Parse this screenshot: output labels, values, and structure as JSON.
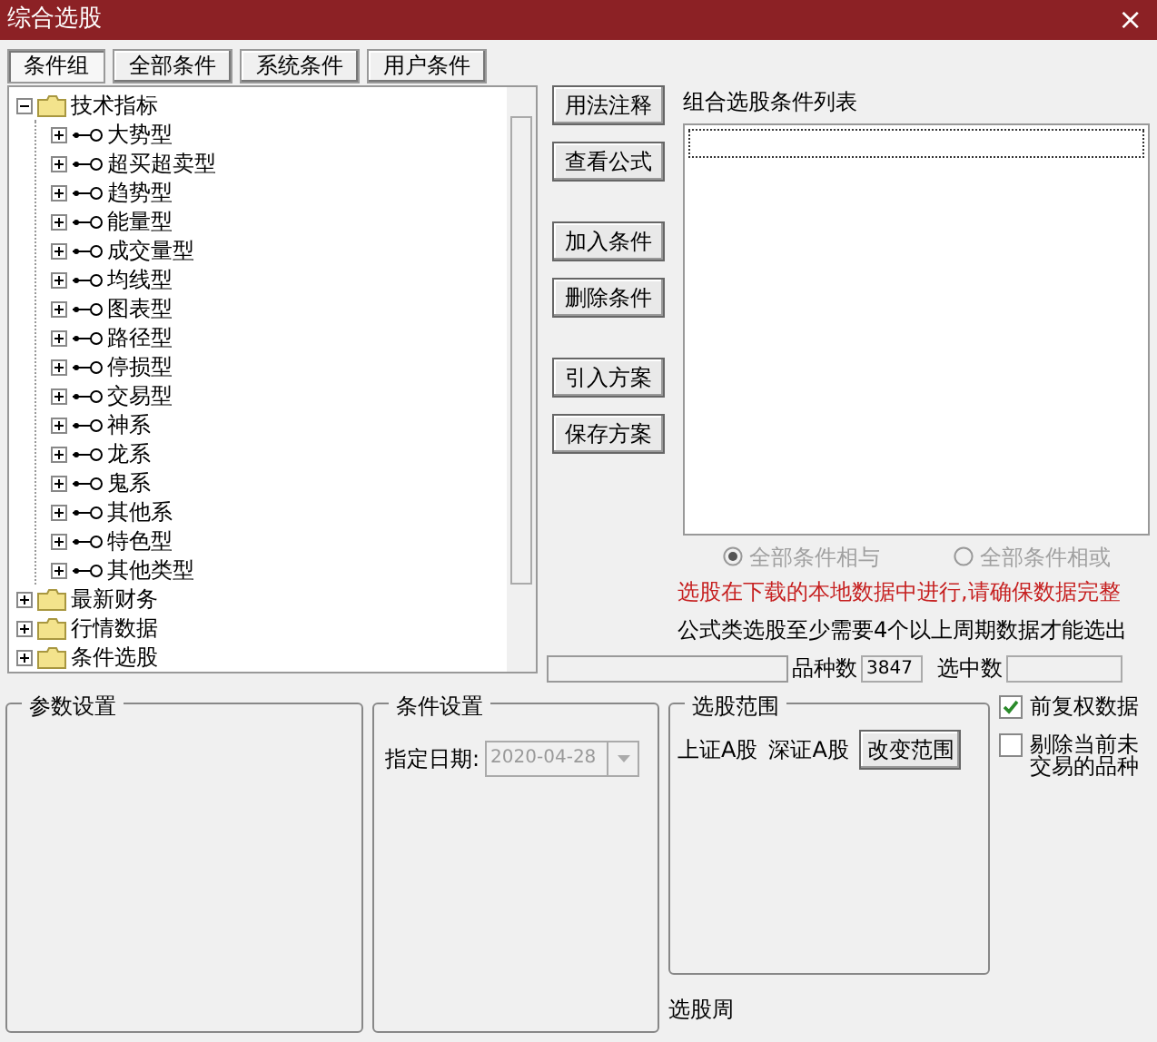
{
  "window": {
    "title": "综合选股",
    "close": "×"
  },
  "tabs": [
    {
      "label": "条件组",
      "selected": true
    },
    {
      "label": "全部条件",
      "selected": false
    },
    {
      "label": "系统条件",
      "selected": false
    },
    {
      "label": "用户条件",
      "selected": false
    }
  ],
  "tree": [
    {
      "label": "技术指标",
      "kind": "folder",
      "expanded": true,
      "children": [
        {
          "label": "大势型",
          "kind": "formula",
          "expanded": false
        },
        {
          "label": "超买超卖型",
          "kind": "formula",
          "expanded": false
        },
        {
          "label": "趋势型",
          "kind": "formula",
          "expanded": false
        },
        {
          "label": "能量型",
          "kind": "formula",
          "expanded": false
        },
        {
          "label": "成交量型",
          "kind": "formula",
          "expanded": false
        },
        {
          "label": "均线型",
          "kind": "formula",
          "expanded": false
        },
        {
          "label": "图表型",
          "kind": "formula",
          "expanded": false
        },
        {
          "label": "路径型",
          "kind": "formula",
          "expanded": false
        },
        {
          "label": "停损型",
          "kind": "formula",
          "expanded": false
        },
        {
          "label": "交易型",
          "kind": "formula",
          "expanded": false
        },
        {
          "label": "神系",
          "kind": "formula",
          "expanded": false
        },
        {
          "label": "龙系",
          "kind": "formula",
          "expanded": false
        },
        {
          "label": "鬼系",
          "kind": "formula",
          "expanded": false
        },
        {
          "label": "其他系",
          "kind": "formula",
          "expanded": false
        },
        {
          "label": "特色型",
          "kind": "formula",
          "expanded": false
        },
        {
          "label": "其他类型",
          "kind": "formula",
          "expanded": false
        }
      ]
    },
    {
      "label": "最新财务",
      "kind": "folder",
      "expanded": false
    },
    {
      "label": "行情数据",
      "kind": "folder",
      "expanded": false
    },
    {
      "label": "条件选股",
      "kind": "folder",
      "expanded": false
    }
  ],
  "button_groups": [
    [
      "用法注释",
      "查看公式"
    ],
    [
      "加入条件",
      "删除条件"
    ],
    [
      "引入方案",
      "保存方案"
    ]
  ],
  "condition_list": {
    "title": "组合选股条件列表"
  },
  "logic": [
    {
      "label": "全部条件相与",
      "selected": true,
      "disabled": true
    },
    {
      "label": "全部条件相或",
      "selected": false,
      "disabled": true
    }
  ],
  "notes": [
    {
      "text": "选股在下载的本地数据中进行,请确保数据完整",
      "kind": "warning"
    },
    {
      "text": "公式类选股至少需要4个以上周期数据才能选出",
      "kind": "info"
    }
  ],
  "status": {
    "level": 0,
    "count_label": "品种数",
    "count": "3847",
    "selected_label": "选中数"
  },
  "params": {
    "title": "参数设置"
  },
  "condition_settings": {
    "title": "条件设置",
    "date_label": "指定日期:",
    "date_value": "2020-04-28",
    "disabled": true
  },
  "range": {
    "title": "选股范围",
    "markets": [
      "上证A股",
      "深证A股"
    ],
    "button": "改变范围"
  },
  "options": [
    {
      "label": "前复权数据",
      "checked": true
    },
    {
      "label": "剔除当前未交易的品种",
      "checked": false
    }
  ],
  "period_label": "选股周"
}
